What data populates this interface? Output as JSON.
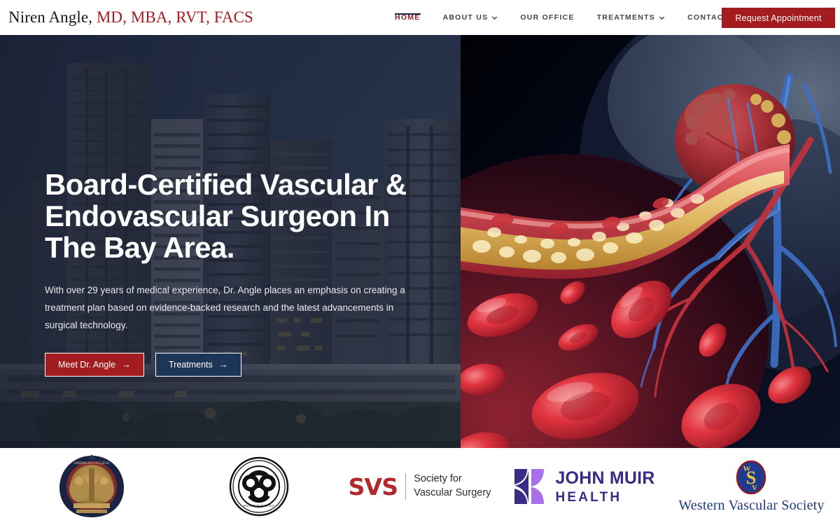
{
  "header": {
    "brand_name": "Niren Angle,",
    "brand_credentials": "MD, MBA, RVT, FACS",
    "nav": [
      {
        "label": "HOME",
        "active": true,
        "has_dropdown": false
      },
      {
        "label": "ABOUT US",
        "active": false,
        "has_dropdown": true
      },
      {
        "label": "OUR OFFICE",
        "active": false,
        "has_dropdown": false
      },
      {
        "label": "TREATMENTS",
        "active": false,
        "has_dropdown": true
      },
      {
        "label": "CONTACT US",
        "active": false,
        "has_dropdown": false
      }
    ],
    "appointment_button": "Request Appointment",
    "accent_red": "#a31c20",
    "nav_text_color": "#3d4350",
    "underline_color": "#1d2c44"
  },
  "hero": {
    "headline_line1": "Board-Certified Vascular &",
    "headline_line2": "Endovascular Surgeon In",
    "headline_line3": "The Bay Area.",
    "subtext": "With over 29 years of medical experience, Dr. Angle places an emphasis on creating a treatment plan based on evidence-backed research and the latest advancements in surgical technology.",
    "primary_button": "Meet Dr. Angle",
    "secondary_button": "Treatments",
    "arrow_glyph": "→",
    "left_image_alt": "city-skyline-dusk",
    "right_image_alt": "artery-plaque-heart-illustration",
    "primary_button_color": "#a31c20",
    "secondary_button_color": "#1d3557"
  },
  "logos": {
    "items": [
      {
        "name": "American College of Surgeons",
        "type": "seal"
      },
      {
        "name": "The American Board of Surgery",
        "type": "seal"
      },
      {
        "name": "SVS Society for Vascular Surgery",
        "type": "svs"
      },
      {
        "name": "John Muir Health",
        "type": "jmh"
      },
      {
        "name": "Western Vascular Society",
        "type": "wvs"
      }
    ],
    "svs_mark": "SVS",
    "svs_line1": "Society for",
    "svs_line2": "Vascular Surgery",
    "jmh_line1": "JOHN MUIR",
    "jmh_line2": "HEALTH",
    "wvs_text": "Western Vascular Society",
    "svs_color": "#b3282d",
    "jmh_color": "#3b2b86",
    "wvs_color": "#1f3a79"
  }
}
